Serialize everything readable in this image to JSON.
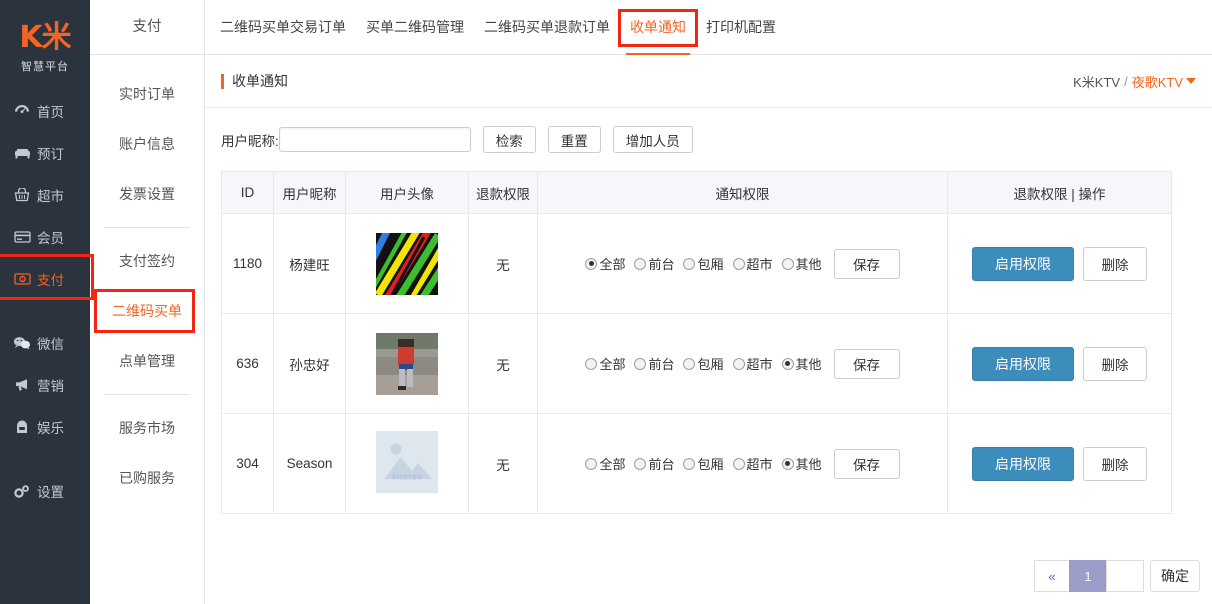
{
  "brand": {
    "logo_text": "K米",
    "logo_sub": "智慧平台",
    "accent": "#f26522",
    "highlight_box": "#f22613",
    "primary_button": "#3c8dbc",
    "pager_current": "#9a9ec9"
  },
  "sidebar": {
    "items": [
      {
        "label": "首页",
        "icon": "dashboard-icon",
        "active": false
      },
      {
        "label": "预订",
        "icon": "sofa-icon",
        "active": false
      },
      {
        "label": "超市",
        "icon": "basket-icon",
        "active": false
      },
      {
        "label": "会员",
        "icon": "card-icon",
        "active": false
      },
      {
        "label": "支付",
        "icon": "money-icon",
        "active": true
      },
      {
        "label": "微信",
        "icon": "wechat-icon",
        "active": false
      },
      {
        "label": "营销",
        "icon": "megaphone-icon",
        "active": false
      },
      {
        "label": "娱乐",
        "icon": "game-icon",
        "active": false
      },
      {
        "label": "设置",
        "icon": "gears-icon",
        "active": false
      }
    ]
  },
  "submenu": {
    "title": "支付",
    "items": [
      {
        "label": "实时订单",
        "active": false
      },
      {
        "label": "账户信息",
        "active": false
      },
      {
        "label": "发票设置",
        "active": false
      },
      {
        "label": "支付签约",
        "active": false
      },
      {
        "label": "二维码买单",
        "active": true
      },
      {
        "label": "点单管理",
        "active": false
      },
      {
        "label": "服务市场",
        "active": false
      },
      {
        "label": "已购服务",
        "active": false
      }
    ]
  },
  "tabs": [
    {
      "label": "二维码买单交易订单",
      "active": false
    },
    {
      "label": "买单二维码管理",
      "active": false
    },
    {
      "label": "二维码买单退款订单",
      "active": false
    },
    {
      "label": "收单通知",
      "active": true
    },
    {
      "label": "打印机配置",
      "active": false
    }
  ],
  "page": {
    "title": "收单通知",
    "breadcrumb_root": "K米KTV",
    "breadcrumb_sep": "/",
    "breadcrumb_current": "夜歌KTV"
  },
  "filter": {
    "label": "用户昵称:",
    "input_value": "",
    "input_placeholder": "",
    "search_label": "检索",
    "reset_label": "重置",
    "add_label": "增加人员"
  },
  "table": {
    "headers": [
      "ID",
      "用户昵称",
      "用户头像",
      "退款权限",
      "通知权限",
      "退款权限 | 操作"
    ],
    "radio_options": [
      "全部",
      "前台",
      "包厢",
      "超市",
      "其他"
    ],
    "save_label": "保存",
    "enable_label": "启用权限",
    "delete_label": "删除",
    "avatar_placeholder_text": "暂时无法查看",
    "rows": [
      {
        "id": "1180",
        "nickname": "杨建旺",
        "avatar_type": "photo-stripes",
        "refund": "无",
        "selected": "全部"
      },
      {
        "id": "636",
        "nickname": "孙忠好",
        "avatar_type": "photo-person",
        "refund": "无",
        "selected": "其他"
      },
      {
        "id": "304",
        "nickname": "Season",
        "avatar_type": "placeholder",
        "refund": "无",
        "selected": "其他"
      }
    ]
  },
  "pagination": {
    "prev_label": "«",
    "current_page": "1",
    "blank_label": "",
    "confirm_label": "确定"
  }
}
